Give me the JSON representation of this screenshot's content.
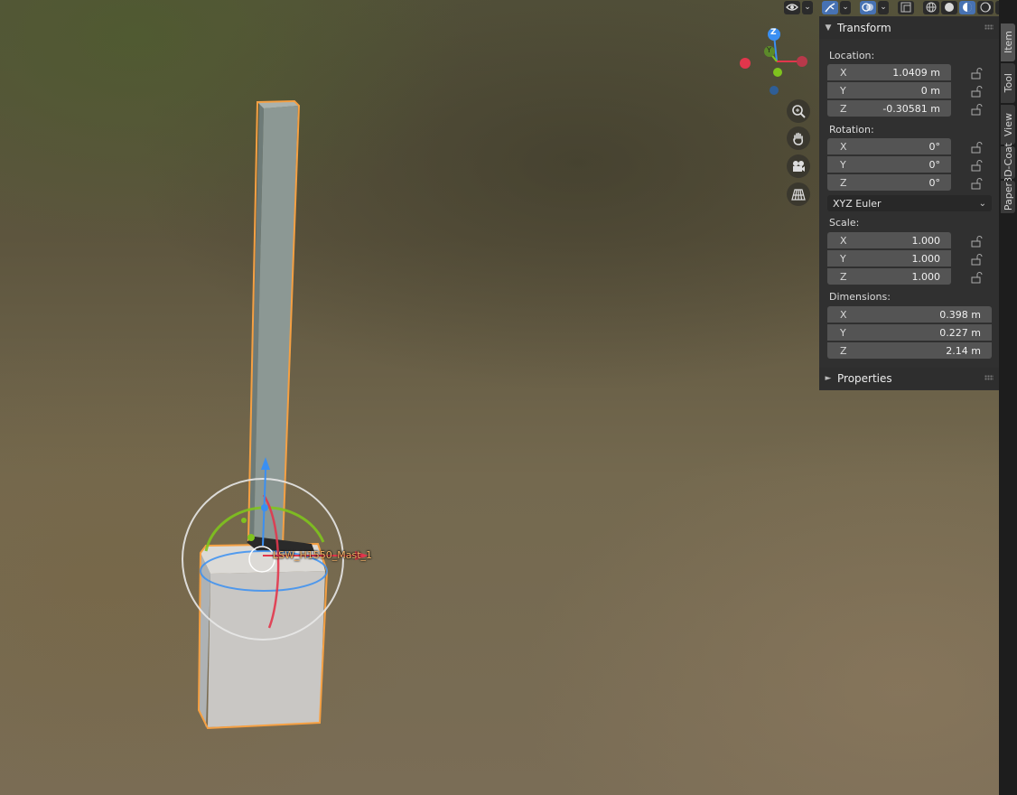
{
  "viewport": {
    "object_label": "LSW_H1550_Mast_1"
  },
  "gizmo": {
    "z": "Z",
    "y": "Y"
  },
  "header_icons": [
    "visibility-icon",
    "gizmo-toggle-icon",
    "overlay-icon",
    "xray-icon",
    "wireframe-shading-icon",
    "solid-shading-icon",
    "material-shading-icon",
    "rendered-shading-icon"
  ],
  "nav_icons": [
    "zoom-icon",
    "pan-hand-icon",
    "camera-icon",
    "perspective-grid-icon"
  ],
  "transform": {
    "title": "Transform",
    "location_label": "Location:",
    "location": [
      {
        "axis": "X",
        "value": "1.0409 m"
      },
      {
        "axis": "Y",
        "value": "0 m"
      },
      {
        "axis": "Z",
        "value": "-0.30581 m"
      }
    ],
    "rotation_label": "Rotation:",
    "rotation": [
      {
        "axis": "X",
        "value": "0°"
      },
      {
        "axis": "Y",
        "value": "0°"
      },
      {
        "axis": "Z",
        "value": "0°"
      }
    ],
    "rotation_mode": "XYZ Euler",
    "scale_label": "Scale:",
    "scale": [
      {
        "axis": "X",
        "value": "1.000"
      },
      {
        "axis": "Y",
        "value": "1.000"
      },
      {
        "axis": "Z",
        "value": "1.000"
      }
    ],
    "dimensions_label": "Dimensions:",
    "dimensions": [
      {
        "axis": "X",
        "value": "0.398 m"
      },
      {
        "axis": "Y",
        "value": "0.227 m"
      },
      {
        "axis": "Z",
        "value": "2.14 m"
      }
    ]
  },
  "properties": {
    "title": "Properties"
  },
  "tabs": [
    "Item",
    "Tool",
    "View",
    "3D-Coat",
    "Paper"
  ],
  "colors": {
    "accent_blue": "#4772b3",
    "selection_orange": "#f5a043",
    "axis_x": "#e2364c",
    "axis_y": "#7fc31e",
    "axis_z": "#3a8ff2"
  }
}
